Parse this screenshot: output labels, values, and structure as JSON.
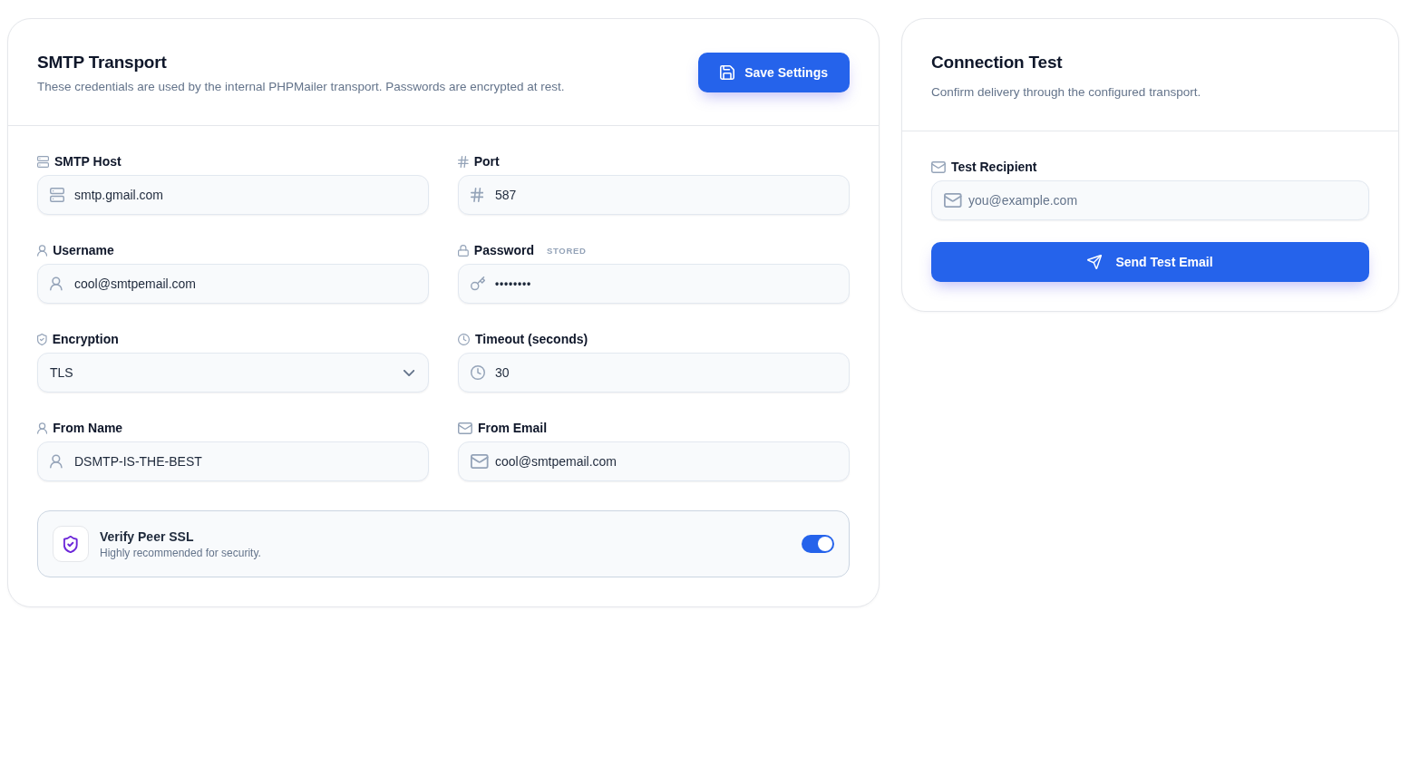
{
  "transport_panel": {
    "title": "SMTP Transport",
    "description": "These credentials are used by the internal PHPMailer transport. Passwords are encrypted at rest.",
    "save_button": {
      "label": "Save Settings"
    },
    "fields": [
      {
        "kind": "text",
        "label": "SMTP Host",
        "value": "smtp.gmail.com"
      },
      {
        "kind": "text",
        "label": "Port",
        "value": "587"
      },
      {
        "kind": "text",
        "label": "Username",
        "value": "cool@smtpemail.com"
      },
      {
        "kind": "password",
        "label": "Password",
        "badge": "STORED",
        "value": "••••••••"
      },
      {
        "kind": "select",
        "label": "Encryption",
        "value": "TLS"
      },
      {
        "kind": "text",
        "label": "Timeout (seconds)",
        "value": "30"
      },
      {
        "kind": "text",
        "label": "From Name",
        "value": "DSMTP-IS-THE-BEST"
      },
      {
        "kind": "text",
        "label": "From Email",
        "value": "cool@smtpemail.com"
      }
    ],
    "verify_ssl": {
      "title": "Verify Peer SSL",
      "subtitle": "Highly recommended for security.",
      "on": true
    }
  },
  "test_panel": {
    "title": "Connection Test",
    "description": "Confirm delivery through the configured transport.",
    "recipient": {
      "label": "Test Recipient",
      "placeholder": "you@example.com"
    },
    "send_button": {
      "label": "Send Test Email"
    }
  }
}
